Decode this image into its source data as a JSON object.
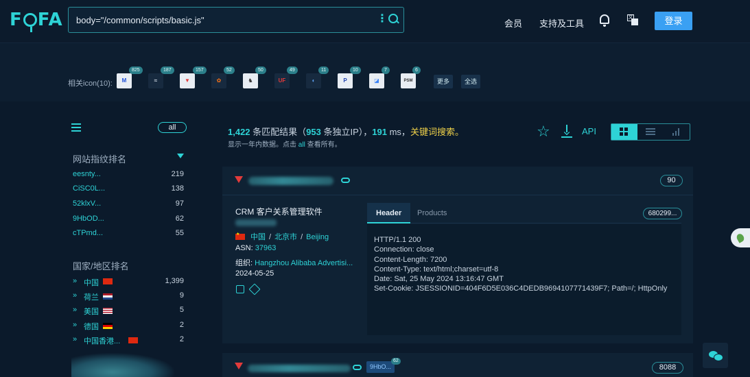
{
  "header": {
    "logo": "FOFA",
    "search_query": "body=\"/common/scripts/basic.js\"",
    "nav": [
      "会员",
      "支持及工具"
    ],
    "login_label": "登录"
  },
  "icon_strip": {
    "label": "相关icon(10):",
    "icons": [
      {
        "glyph": "M",
        "count": "825"
      },
      {
        "glyph": "≈",
        "count": "187"
      },
      {
        "glyph": "▼",
        "count": "157"
      },
      {
        "glyph": "✿",
        "count": "52"
      },
      {
        "glyph": "♞",
        "count": "50"
      },
      {
        "glyph": "UF",
        "count": "49"
      },
      {
        "glyph": "◐",
        "count": "11"
      },
      {
        "glyph": "P",
        "count": "10"
      },
      {
        "glyph": "◪",
        "count": "7"
      },
      {
        "glyph": "PSM",
        "count": "6"
      }
    ],
    "more_label": "更多",
    "select_all_label": "全选"
  },
  "sidebar": {
    "all_label": "all",
    "fingerprint_title": "网站指纹排名",
    "fingerprints": [
      {
        "name": "eesnty...",
        "count": "219"
      },
      {
        "name": "CiSC0L...",
        "count": "138"
      },
      {
        "name": "52klxV...",
        "count": "97"
      },
      {
        "name": "9HbOD...",
        "count": "62"
      },
      {
        "name": "cTPmd...",
        "count": "55"
      }
    ],
    "country_title": "国家/地区排名",
    "countries": [
      {
        "name": "中国",
        "count": "1,399",
        "flag_color": "#de2910"
      },
      {
        "name": "荷兰",
        "count": "9",
        "flag_color": "#21468b"
      },
      {
        "name": "美国",
        "count": "5",
        "flag_color": "#3c3b6e"
      },
      {
        "name": "德国",
        "count": "2",
        "flag_color": "#dd0000"
      },
      {
        "name": "中国香港...",
        "count": "2",
        "flag_color": "#de2910"
      }
    ]
  },
  "summary": {
    "total": "1,422",
    "total_suffix": " 条匹配结果（",
    "ips": "953",
    "ips_suffix": " 条独立IP），",
    "time": "191",
    "time_suffix": " ms，",
    "keyword_label": "关键词搜索。",
    "sub_prefix": "显示一年内数据。点击 ",
    "sub_link": "all",
    "sub_suffix": " 查看所有。",
    "api_label": "API"
  },
  "result1": {
    "score": "90",
    "title": "CRM 客户关系管理软件",
    "country": "中国",
    "region": "北京市",
    "city": "Beijing",
    "asn_label": "ASN: ",
    "asn": "37963",
    "org_label": "组织: ",
    "org": "Hangzhou Alibaba Advertisi...",
    "date": "2024-05-25",
    "tab_header": "Header",
    "tab_products": "Products",
    "cert_id": "680299...",
    "headers": [
      "HTTP/1.1 200",
      "Connection: close",
      "Content-Length: 7200",
      "Content-Type: text/html;charset=utf-8",
      "Date: Sat, 25 May 2024 13:16:47 GMT",
      "Set-Cookie: JSESSIONID=404F6D5E036C4DEDB9694107771439F7; Path=/; HttpOnly"
    ]
  },
  "result2": {
    "tag": "9HbO...",
    "tag_count": "62",
    "port": "8088"
  },
  "colors": {
    "accent": "#2ed3d6",
    "login": "#3aa0f3",
    "highlight": "#f0d24a"
  }
}
